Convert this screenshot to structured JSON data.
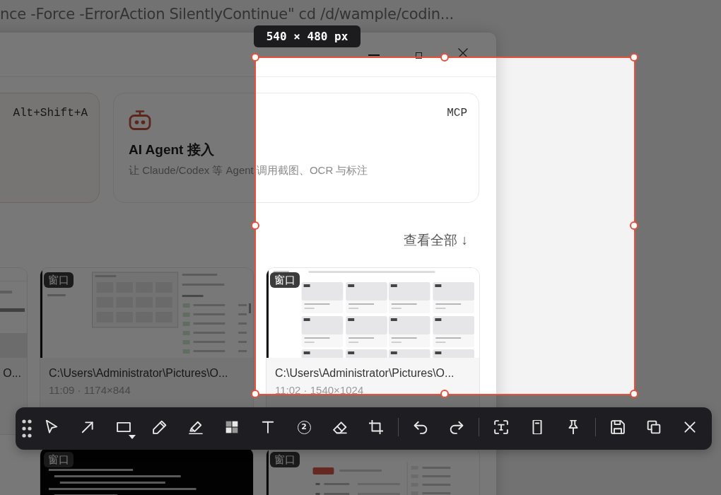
{
  "terminal": {
    "command_text": "nce -Force -ErrorAction SilentlyContinue\" cd /d/wample/codin..."
  },
  "feature_cards": [
    {
      "kind": "shortcut",
      "tag": "Alt+Shift+A",
      "highlighted": true
    },
    {
      "kind": "agent",
      "tag": "MCP",
      "title": "AI Agent 接入",
      "description": "让 Claude/Codex 等 Agent 调用截图、OCR 与标注",
      "highlighted": false
    }
  ],
  "view_all_link": "查看全部 ↓",
  "captures": [
    {
      "kind": "partial",
      "caption": "O..."
    },
    {
      "kind": "full",
      "badge": "窗口",
      "caption": "C:\\Users\\Administrator\\Pictures\\O...",
      "meta": "11:09 · 1174×844"
    },
    {
      "kind": "full",
      "badge": "窗口",
      "caption": "C:\\Users\\Administrator\\Pictures\\O...",
      "meta": "11:02 · 1540×1024"
    },
    {
      "kind": "full",
      "badge": "窗口"
    },
    {
      "kind": "full",
      "badge": "窗口"
    }
  ],
  "selection": {
    "size_label": "540 × 480 px"
  },
  "toolbar": {
    "tools": [
      {
        "kind": "grip"
      },
      {
        "kind": "select"
      },
      {
        "kind": "arrow"
      },
      {
        "kind": "rectangle"
      },
      {
        "kind": "pen"
      },
      {
        "kind": "highlighter"
      },
      {
        "kind": "mosaic"
      },
      {
        "kind": "text"
      },
      {
        "kind": "step",
        "label": "2"
      },
      {
        "kind": "eraser"
      },
      {
        "kind": "crop"
      },
      {
        "kind": "separator"
      },
      {
        "kind": "undo"
      },
      {
        "kind": "redo"
      },
      {
        "kind": "separator"
      },
      {
        "kind": "ocr"
      },
      {
        "kind": "scroll"
      },
      {
        "kind": "pin"
      },
      {
        "kind": "separator"
      },
      {
        "kind": "save"
      },
      {
        "kind": "copy"
      },
      {
        "kind": "close"
      }
    ]
  }
}
